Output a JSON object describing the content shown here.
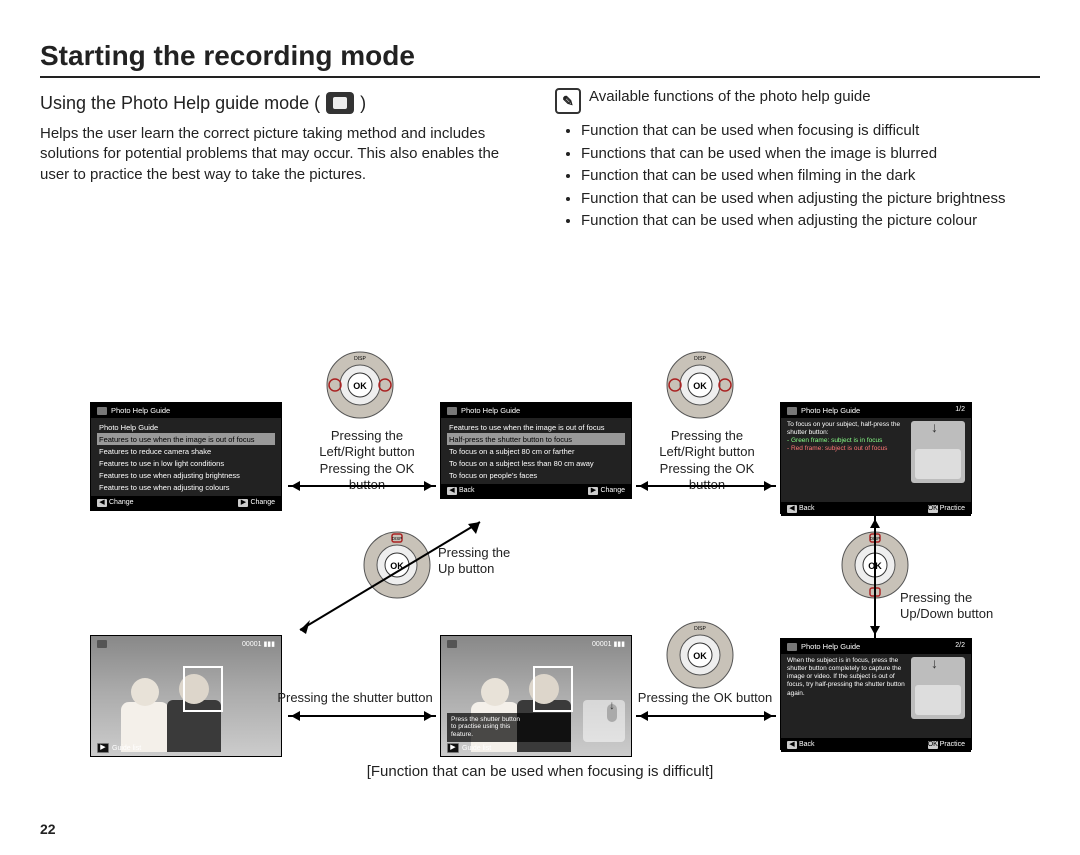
{
  "page_number": "22",
  "title": "Starting the recording mode",
  "subheading_prefix": "Using the Photo Help guide mode (",
  "subheading_suffix": ")",
  "intro": "Helps the user learn the correct picture taking method and includes solutions for potential problems that may occur. This also enables the user to practice the best way to take the pictures.",
  "note_heading": "Available functions of the photo help guide",
  "note_icon_glyph": "✎",
  "bullets": [
    "Function that can be used when focusing is difficult",
    "Functions that can be used when the image is blurred",
    "Function that can be used when filming in the dark",
    "Function that can be used when adjusting the picture brightness",
    "Function that can be used when adjusting the picture colour"
  ],
  "captions": {
    "lr_ok_1": "Pressing the",
    "lr_ok_2": "Left/Right button",
    "lr_ok_3": "Pressing the OK button",
    "up_1": "Pressing the",
    "up_2": "Up button",
    "updown_1": "Pressing the",
    "updown_2": "Up/Down button",
    "shutter": "Pressing the shutter button",
    "ok": "Pressing the OK button"
  },
  "bottom_caption": "[Function that can be used when focusing is difficult]",
  "screen1": {
    "header": "Photo Help Guide",
    "subtitle": "Photo Help Guide",
    "items": [
      "Features to use when the image is out of focus",
      "Features to reduce camera shake",
      "Features to use in low light conditions",
      "Features to use when adjusting brightness",
      "Features to use when adjusting colours"
    ],
    "selected": 0,
    "footer_left": "Change",
    "footer_left_key": "◀",
    "footer_right": "Change",
    "footer_right_key": "▶"
  },
  "screen2": {
    "header": "Photo Help Guide",
    "subtitle": "Features to use when the image is out of focus",
    "items": [
      "Half-press the shutter button to focus",
      "To focus on a subject 80 cm or farther",
      "To focus on a subject less than 80 cm away",
      "To focus on people's faces"
    ],
    "selected": 0,
    "footer_left": "Back",
    "footer_left_key": "◀",
    "footer_right": "Change",
    "footer_right_key": "▶"
  },
  "screen_tip1": {
    "header": "Photo Help Guide",
    "page": "1/2",
    "text_lines": [
      "To focus on your subject, half-press the shutter button:",
      "- Green frame: subject is in focus",
      "- Red frame: subject is out of focus"
    ],
    "footer_left": "Back",
    "footer_left_key": "◀",
    "footer_right": "Practice",
    "footer_right_key": "OK"
  },
  "screen_tip2": {
    "header": "Photo Help Guide",
    "page": "2/2",
    "text": "When the subject is in focus, press the shutter button completely to capture the image or video. If the subject is out of focus, try half-pressing the shutter button again.",
    "footer_left": "Back",
    "footer_left_key": "◀",
    "footer_right": "Practice",
    "footer_right_key": "OK"
  },
  "screen_photo": {
    "top_left_icon": "mode-icon",
    "top_right": "00001  ▮▮▮",
    "bottom": "Guide list",
    "bottom_key": "▶"
  },
  "screen_photo_overlay": {
    "line1": "Press the shutter button",
    "line2": "to practise using this",
    "line3": "feature."
  },
  "dial_labels": {
    "top": "DISP",
    "center": "OK"
  }
}
